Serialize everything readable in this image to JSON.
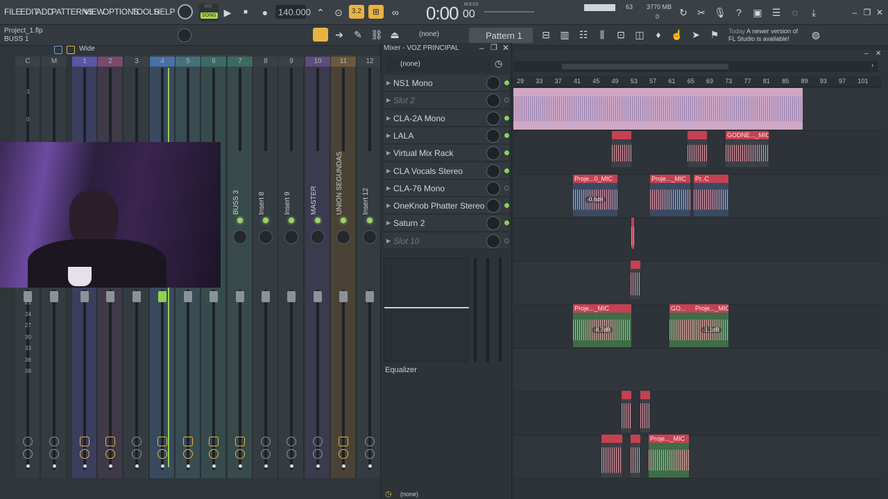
{
  "menu": [
    "FILE",
    "EDIT",
    "ADD",
    "PATTERNS",
    "VIEW",
    "OPTIONS",
    "TOOLS",
    "HELP"
  ],
  "transport": {
    "pat_label": "PAT",
    "song_label": "SONG",
    "tempo": "140.000",
    "time": "0:00",
    "time_small": "00",
    "time_unit": "M:S:CS",
    "cpu_value": "63",
    "memory": "3770 MB",
    "poly": "0"
  },
  "project": {
    "file": "Project_1.flp",
    "selected": "BUSS 1"
  },
  "toolbar": {
    "pattern_none": "(none)",
    "pattern_name": "Pattern 1",
    "news_prefix": "Today",
    "news_text": "A newer version of",
    "news_text2": "FL Studio is available!"
  },
  "mixer": {
    "wide_label": "Wide",
    "header_channels": [
      "C",
      "M",
      "1",
      "2",
      "3",
      "4",
      "5",
      "6",
      "7",
      "8",
      "9",
      "10",
      "11",
      "12"
    ],
    "vertical_names": [
      "BUSS 3",
      "Insert 8",
      "Insert 9",
      "MASTER",
      "UNION SEGUNDAS",
      "Insert 12"
    ],
    "upper_scale": [
      "3",
      "0"
    ],
    "lower_scale": [
      "21",
      "24",
      "27",
      "30",
      "33",
      "36",
      "39"
    ]
  },
  "insert_panel": {
    "title": "Mixer - VOZ PRINCIPAL",
    "preset": "(none)",
    "slots": [
      {
        "name": "NS1 Mono",
        "empty": false,
        "active": true
      },
      {
        "name": "Slot 2",
        "empty": true,
        "active": false
      },
      {
        "name": "CLA-2A Mono",
        "empty": false,
        "active": true
      },
      {
        "name": "LALA",
        "empty": false,
        "active": true
      },
      {
        "name": "Virtual Mix Rack",
        "empty": false,
        "active": true
      },
      {
        "name": "CLA Vocals Stereo",
        "empty": false,
        "active": true
      },
      {
        "name": "CLA-76 Mono",
        "empty": false,
        "active": false
      },
      {
        "name": "OneKnob Phatter Stereo",
        "empty": false,
        "active": true
      },
      {
        "name": "Saturn 2",
        "empty": false,
        "active": true
      },
      {
        "name": "Slot 10",
        "empty": true,
        "active": false
      }
    ],
    "eq_label": "Equalizer",
    "route_none": "(none)"
  },
  "playlist": {
    "ruler": [
      "29",
      "33",
      "37",
      "41",
      "45",
      "49",
      "53",
      "57",
      "61",
      "65",
      "69",
      "73",
      "77",
      "81",
      "85",
      "89",
      "93",
      "97",
      "101"
    ],
    "clips": [
      {
        "label": "",
        "row": 0,
        "db": ""
      },
      {
        "label": "",
        "row": 1,
        "db": ""
      },
      {
        "label": "",
        "row": 1,
        "db": ""
      },
      {
        "label": "GODNE..._MIC",
        "row": 1,
        "db": ""
      },
      {
        "label": "Proje...0_MIC",
        "row": 2,
        "db": "-0.6dB"
      },
      {
        "label": "Proje..._MIC",
        "row": 2,
        "db": ""
      },
      {
        "label": "Pr..C",
        "row": 2,
        "db": ""
      },
      {
        "label": "Proje..._MIC",
        "row": 5,
        "db": "-8.7dB"
      },
      {
        "label": "GO...",
        "row": 5,
        "db": ""
      },
      {
        "label": "Proje..._MIC",
        "row": 5,
        "db": "-1.1dB"
      },
      {
        "label": "Proje..._MIC",
        "row": 9,
        "db": ""
      }
    ]
  },
  "colors": {
    "accent_green": "#9bd36a",
    "accent_orange": "#e9b243",
    "clip_red": "#c54152",
    "clip_pink": "#f29aa8",
    "clip_green": "#3e6d48"
  }
}
